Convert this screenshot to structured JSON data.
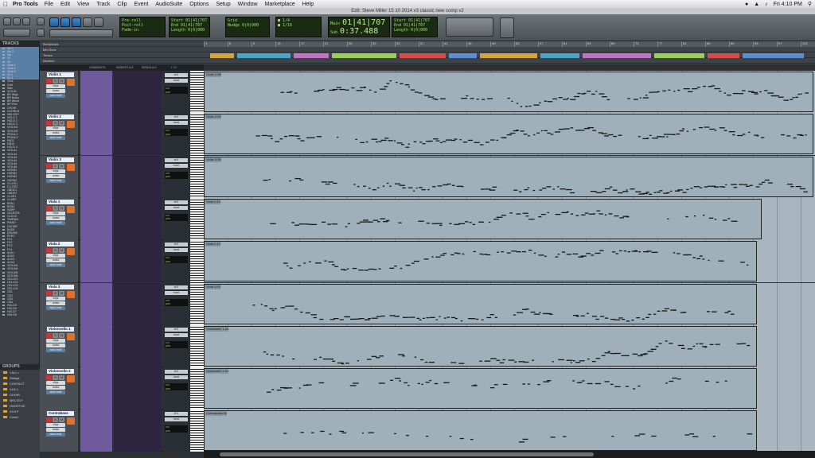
{
  "menubar": {
    "apple": "",
    "app": "Pro Tools",
    "items": [
      "File",
      "Edit",
      "View",
      "Track",
      "Clip",
      "Event",
      "AudioSuite",
      "Options",
      "Setup",
      "Window",
      "Marketplace",
      "Help"
    ],
    "clock": "Fri 4:10 PM"
  },
  "window_title": "Edit: Steve Miller 15 10 2014 v3 classic new comp v2",
  "toolbar": {
    "counter_main": "01|41|707",
    "counter_sub": "0:37.488",
    "start": "01|41|707",
    "end": "01|41|707",
    "length": "0|0|000",
    "nudge": "0|0|000",
    "grid": "Grid",
    "nudge_label": "Nudge",
    "main_label": "Main",
    "sub_label": "Sub",
    "start_label": "Start",
    "end_label": "End",
    "length_label": "Length"
  },
  "rulers": {
    "rows": [
      "Bars|Beats",
      "Min:Secs",
      "Tempo",
      "Markers"
    ],
    "bar_numbers": [
      "1",
      "5",
      "9",
      "13",
      "17",
      "21",
      "25",
      "29",
      "33",
      "37",
      "41",
      "45",
      "49",
      "53",
      "57",
      "61",
      "65",
      "69",
      "73",
      "77",
      "81",
      "85",
      "89",
      "93",
      "97",
      "101"
    ]
  },
  "tracks_panel": {
    "title": "TRACKS",
    "items": [
      "Vln 1",
      "Vln 2",
      "Vla",
      "Vc",
      "Cb",
      "Viola 1",
      "Viola 2",
      "Viola 3",
      "Vc 1",
      "Vc 2",
      "Click",
      "Grid",
      "Mstr",
      "VIOLIN",
      "BR Strgs",
      "BR Brass",
      "BR Wood",
      "BR Perc",
      "CHOIR",
      "CHORUS",
      "MELODY",
      "HOLD 1",
      "HOLD 2",
      "HOLD 3",
      "VIOLIN1",
      "VIOLIN2",
      "PEDAL1",
      "PEDAL2",
      "PAD1",
      "PAD2",
      "HOLD 4",
      "VIOLA1",
      "VIOLA2",
      "VIOLA3",
      "VIOLA4",
      "VIOLA5",
      "VIOLA6",
      "HORN1",
      "HORN2",
      "HORN3",
      "HORN4",
      "FLUTE1",
      "FLUTE2",
      "OBOE1",
      "OBOE2",
      "CLAR1",
      "CLAR2",
      "BSN1",
      "BSN2",
      "HARP",
      "CELESTA",
      "GLOCK",
      "TIMPANI",
      "PIANO",
      "GUITAR",
      "BASS",
      "DRUMS",
      "PERC",
      "FX1",
      "FX2",
      "FX3",
      "FX4",
      "AUX1",
      "AUX2",
      "AUX3",
      "AUX4",
      "VIOLIN3",
      "VIOLIN4",
      "VIOLIN5",
      "VIOLIN6",
      "CELLO1",
      "CELLO2",
      "CELLO3",
      "CELLO4",
      "CB1",
      "CB2",
      "CB3",
      "CB4",
      "HOLD5",
      "HOLD6",
      "HOLD7",
      "HOLD8"
    ],
    "selected_count": 10
  },
  "groups_panel": {
    "title": "GROUPS",
    "items": [
      "<ALL>",
      "Strings",
      "CONTACT",
      "VLN 1",
      "CHOIR",
      "MELODY",
      "ONOFFUE",
      "VLN F",
      "Contrl"
    ]
  },
  "column_headers": [
    "COMMENTS",
    "INSERTS A-E",
    "SENDS A-E",
    "I / O"
  ],
  "tracks": [
    {
      "name": "Violin 1",
      "clip": "Violin 1.08",
      "clip_end": 1,
      "input": "ch1",
      "output": "none",
      "vol": "vol",
      "pan": "pan",
      "density": 1
    },
    {
      "name": "Violin 2",
      "clip": "Violin 2.09",
      "clip_end": 1,
      "input": "ch1",
      "output": "none",
      "vol": "vol",
      "pan": "pan",
      "density": 1
    },
    {
      "name": "Violin 3",
      "clip": "Violin 3.09",
      "clip_end": 1,
      "input": "ch1",
      "output": "none",
      "vol": "vol",
      "pan": "pan",
      "density": 1
    },
    {
      "name": "Viola 1",
      "clip": "Viola 1.43",
      "clip_end": 0.915,
      "input": "ch1",
      "output": "none",
      "vol": "vol",
      "pan": "pan",
      "density": 0.8
    },
    {
      "name": "Viola 2",
      "clip": "Viola 2.43",
      "clip_end": 0.907,
      "input": "ch1",
      "output": "none",
      "vol": "vol",
      "pan": "pan",
      "density": 0.8
    },
    {
      "name": "Viola 3",
      "clip": "Viola 3.43",
      "clip_end": 0.907,
      "input": "ch1",
      "output": "none",
      "vol": "vol",
      "pan": "pan",
      "density": 0.9
    },
    {
      "name": "Violoncello 1",
      "clip": "Violoncello 1.33",
      "clip_end": 0.907,
      "input": "ch1",
      "output": "none",
      "vol": "vol",
      "pan": "pan",
      "density": 0.9
    },
    {
      "name": "Violoncello 2",
      "clip": "Violoncello 2.01",
      "clip_end": 0.907,
      "input": "ch1",
      "output": "none",
      "vol": "vol",
      "pan": "pan",
      "density": 0.6
    },
    {
      "name": "Contrabass",
      "clip": "Contrabass.01",
      "clip_end": 0.907,
      "input": "ch1",
      "output": "none",
      "vol": "vol",
      "pan": "pan",
      "density": 0.3
    }
  ],
  "track_buttons": {
    "solo": "S",
    "mute": "M",
    "mode_1": "clips",
    "mode_2": "notes",
    "auto": "auto read"
  },
  "colors": {
    "comments": "#6f5a9e",
    "inserts": "#2e2640",
    "clip_bg": "#9fb0ba",
    "lcd_text": "#9fe07a",
    "marker_colors": [
      "#d9a23b",
      "#49a5c9",
      "#c770c7",
      "#9ad05a",
      "#d94a4a",
      "#5b8ed6"
    ]
  }
}
